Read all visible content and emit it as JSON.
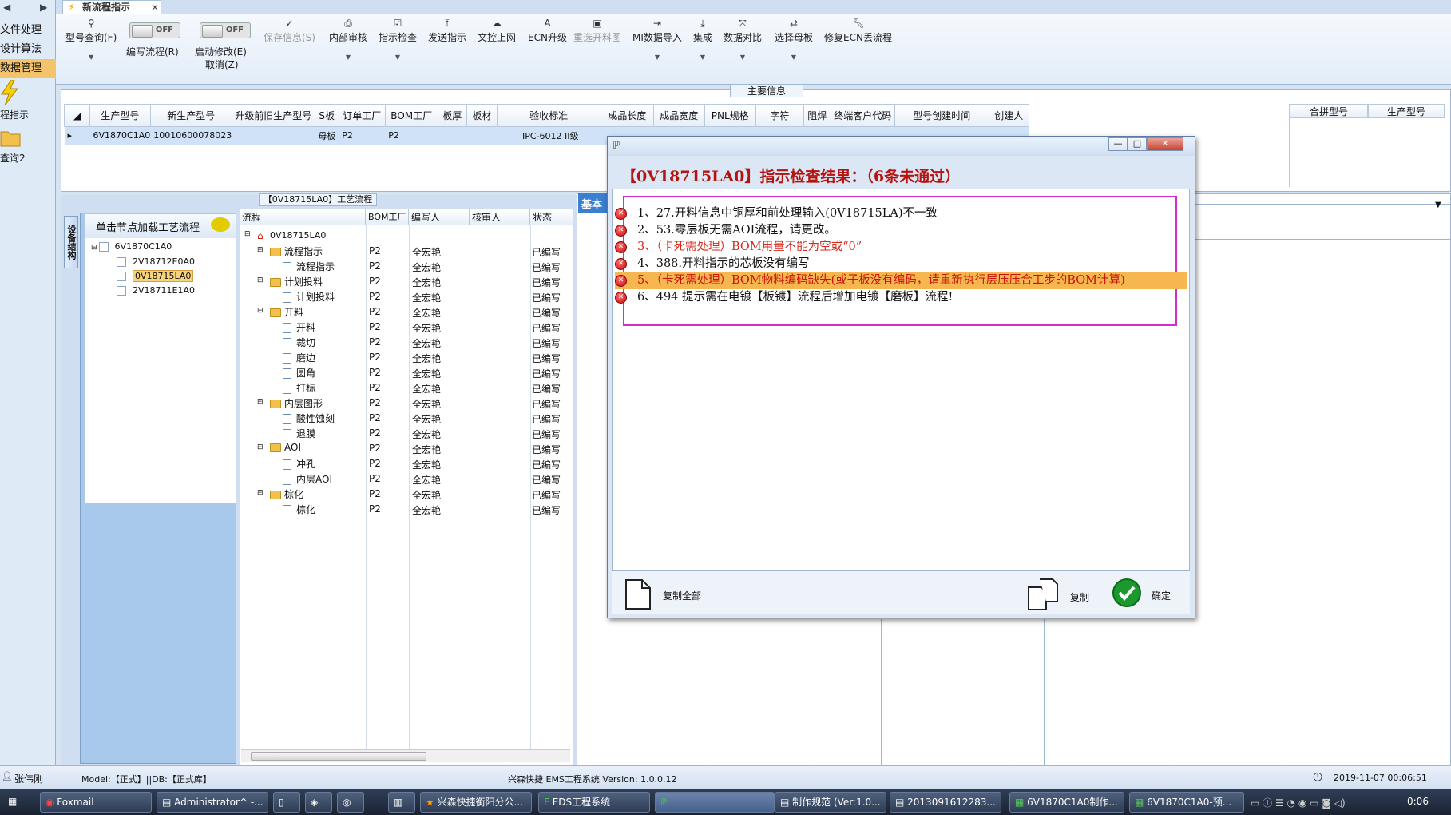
{
  "left_nav": {
    "items": [
      "文件处理",
      "设计算法",
      "数据管理"
    ],
    "selected_index": 2,
    "icons": [
      {
        "name": "flow-indicator-icon",
        "label": "程指示"
      },
      {
        "name": "folder-query-icon",
        "label": "查询2"
      }
    ]
  },
  "tabs": {
    "active": "新流程指示"
  },
  "ribbon": {
    "items": [
      {
        "label": "型号查询(F)",
        "icon": "search-icon",
        "enabled": true,
        "dropdown": true
      },
      {
        "label": "编写流程(R)",
        "toggle": "OFF"
      },
      {
        "label": "启动修改(E)",
        "label2": "取消(Z)",
        "toggle": "OFF"
      },
      {
        "label": "保存信息(S)",
        "icon": "check-icon",
        "enabled": false
      },
      {
        "label": "内部审核",
        "icon": "printer-icon",
        "enabled": true,
        "dropdown": true
      },
      {
        "label": "指示检查",
        "icon": "checklist-icon",
        "enabled": true,
        "dropdown": true
      },
      {
        "label": "发送指示",
        "icon": "upload-icon",
        "enabled": true
      },
      {
        "label": "文控上网",
        "icon": "cloud-upload-icon",
        "enabled": true
      },
      {
        "label": "ECN升级",
        "icon": "ecn-icon",
        "enabled": true
      },
      {
        "label": "重选开料图",
        "icon": "image-icon",
        "enabled": false
      },
      {
        "label": "MI数据导入",
        "icon": "import-icon",
        "enabled": true,
        "dropdown": true
      },
      {
        "label": "集成",
        "icon": "download-icon",
        "enabled": true,
        "dropdown": true
      },
      {
        "label": "数据对比",
        "icon": "compare-icon",
        "enabled": true,
        "dropdown": true
      },
      {
        "label": "选择母板",
        "icon": "shuffle-icon",
        "enabled": true,
        "dropdown": true
      },
      {
        "label": "修复ECN丢流程",
        "icon": "wrench-icon",
        "enabled": true
      }
    ]
  },
  "main_info": {
    "title": "主要信息",
    "columns": [
      "生产型号",
      "新生产型号",
      "升级前旧生产型号",
      "S板",
      "订单工厂",
      "BOM工厂",
      "板厚",
      "板材",
      "验收标准",
      "成品长度",
      "成品宽度",
      "PNL规格",
      "字符",
      "阻焊",
      "终端客户代码",
      "型号创建时间",
      "创建人"
    ],
    "row": [
      "6V1870C1A0",
      "10010600078023",
      "",
      "母板",
      "P2",
      "P2",
      "",
      "",
      "IPC-6012 II级",
      "",
      "",
      "",
      "",
      "",
      "",
      "",
      ""
    ],
    "side_columns": [
      "合拼型号",
      "生产型号"
    ]
  },
  "tree": {
    "vertical_tab": "设备结构",
    "header": "单击节点加载工艺流程",
    "nodes": [
      {
        "label": "6V1870C1A0",
        "level": 0
      },
      {
        "label": "2V18712E0A0",
        "level": 1
      },
      {
        "label": "0V18715LA0",
        "level": 1,
        "selected": true
      },
      {
        "label": "2V18711E1A0",
        "level": 1
      }
    ]
  },
  "flow": {
    "title": "【0V18715LA0】工艺流程",
    "columns": [
      "流程",
      "BOM工厂",
      "编写人",
      "核审人",
      "状态"
    ],
    "root": "0V18715LA0",
    "rows": [
      {
        "name": "流程指示",
        "type": "folder",
        "bom": "P2",
        "writer": "全宏艳",
        "status": "已编写"
      },
      {
        "name": "流程指示",
        "type": "doc",
        "bom": "P2",
        "writer": "全宏艳",
        "status": "已编写"
      },
      {
        "name": "计划投料",
        "type": "folder",
        "bom": "P2",
        "writer": "全宏艳",
        "status": "已编写"
      },
      {
        "name": "计划投料",
        "type": "doc",
        "bom": "P2",
        "writer": "全宏艳",
        "status": "已编写"
      },
      {
        "name": "开料",
        "type": "folder",
        "bom": "P2",
        "writer": "全宏艳",
        "status": "已编写"
      },
      {
        "name": "开料",
        "type": "doc",
        "bom": "P2",
        "writer": "全宏艳",
        "status": "已编写"
      },
      {
        "name": "裁切",
        "type": "doc",
        "bom": "P2",
        "writer": "全宏艳",
        "status": "已编写"
      },
      {
        "name": "磨边",
        "type": "doc",
        "bom": "P2",
        "writer": "全宏艳",
        "status": "已编写"
      },
      {
        "name": "圆角",
        "type": "doc",
        "bom": "P2",
        "writer": "全宏艳",
        "status": "已编写"
      },
      {
        "name": "打标",
        "type": "doc",
        "bom": "P2",
        "writer": "全宏艳",
        "status": "已编写"
      },
      {
        "name": "内层图形",
        "type": "folder",
        "bom": "P2",
        "writer": "全宏艳",
        "status": "已编写"
      },
      {
        "name": "酸性蚀刻",
        "type": "doc",
        "bom": "P2",
        "writer": "全宏艳",
        "status": "已编写"
      },
      {
        "name": "退膜",
        "type": "doc",
        "bom": "P2",
        "writer": "全宏艳",
        "status": "已编写"
      },
      {
        "name": "AOI",
        "type": "folder",
        "bom": "P2",
        "writer": "全宏艳",
        "status": "已编写"
      },
      {
        "name": "冲孔",
        "type": "doc",
        "bom": "P2",
        "writer": "全宏艳",
        "status": "已编写"
      },
      {
        "name": "内层AOI",
        "type": "doc",
        "bom": "P2",
        "writer": "全宏艳",
        "status": "已编写"
      },
      {
        "name": "棕化",
        "type": "folder",
        "bom": "P2",
        "writer": "全宏艳",
        "status": "已编写"
      },
      {
        "name": "棕化",
        "type": "doc",
        "bom": "P2",
        "writer": "全宏艳",
        "status": "已编写"
      }
    ]
  },
  "right_panel": {
    "tab": "基本"
  },
  "dialog": {
    "heading": "【0V18715LA0】指示检查结果：（6条未通过）",
    "items": [
      {
        "text": "1、27.开料信息中铜厚和前处理输入(0V18715LA)不一致",
        "style": "normal"
      },
      {
        "text": "2、53.零层板无需AOI流程，请更改。",
        "style": "normal"
      },
      {
        "text": "3、（卡死需处理）BOM用量不能为空或“0”",
        "style": "red"
      },
      {
        "text": "4、388.开料指示的芯板没有编写",
        "style": "normal"
      },
      {
        "text": "5、（卡死需处理）BOM物料编码缺失(或子板没有编码，请重新执行层压压合工步的BOM计算)",
        "style": "highlight"
      },
      {
        "text": "6、494 提示需在电镀【板镀】流程后增加电镀【磨板】流程!",
        "style": "normal"
      }
    ],
    "footer": {
      "copy_all": "复制全部",
      "copy": "复制",
      "ok": "确定"
    }
  },
  "status": {
    "user": "张伟刚",
    "model_db": "Model:【正式】||DB:【正式库】",
    "system": "兴森快捷 EMS工程系统 Version: 1.0.0.12",
    "datetime": "2019-11-07 00:06:51"
  },
  "taskbar": {
    "items": [
      "Foxmail",
      "Administrator^ -...",
      "兴森快捷衡阳分公...",
      "EDS工程系统",
      "制作规范 (Ver:1.0...",
      "2013091612283...",
      "6V1870C1A0制作...",
      "6V1870C1A0-预..."
    ],
    "clock": "0:06"
  }
}
